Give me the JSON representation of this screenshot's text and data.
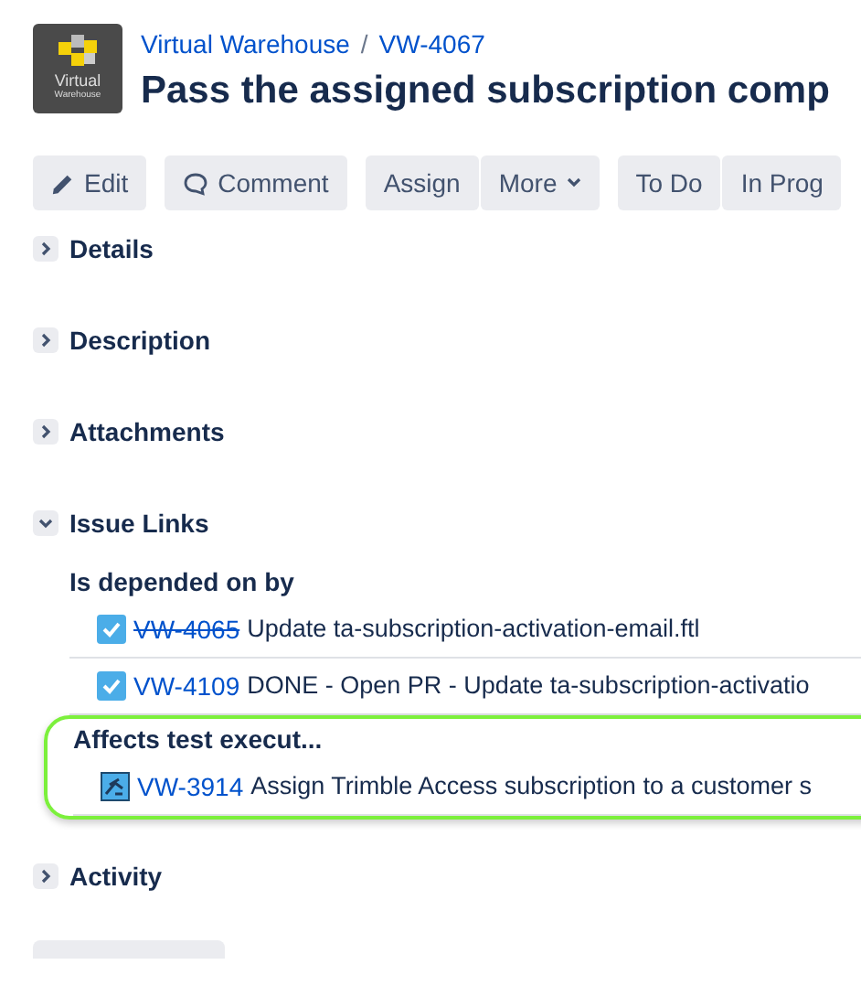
{
  "header": {
    "project_logo_text": "Virtual",
    "project_logo_subtext": "Warehouse",
    "breadcrumbs": [
      "Virtual Warehouse",
      "VW-4067"
    ],
    "breadcrumb_separator": "/",
    "title": "Pass the assigned subscription comp"
  },
  "toolbar": [
    {
      "label": "Edit",
      "kind": "edit"
    },
    {
      "label": "Comment",
      "kind": "comment"
    },
    {
      "label": "Assign",
      "kind": "plain"
    },
    {
      "label": "More",
      "kind": "dropdown"
    },
    {
      "label": "To Do",
      "kind": "plain"
    },
    {
      "label": "In Prog",
      "kind": "plain"
    }
  ],
  "sections": [
    {
      "title": "Details",
      "expanded": false
    },
    {
      "title": "Description",
      "expanded": false
    },
    {
      "title": "Attachments",
      "expanded": false
    },
    {
      "title": "Issue Links",
      "expanded": true,
      "groups": [
        {
          "title": "Is depended on by",
          "highlighted": false,
          "links": [
            {
              "kind": "subtask",
              "key": "VW-4065",
              "resolved": true,
              "summary": "Update ta-subscription-activation-email.ftl"
            },
            {
              "kind": "subtask",
              "key": "VW-4109",
              "resolved": false,
              "summary": "DONE - Open PR - Update ta-subscription-activatio"
            }
          ]
        },
        {
          "title": "Affects test execut...",
          "highlighted": true,
          "links": [
            {
              "kind": "test-execution",
              "key": "VW-3914",
              "resolved": false,
              "summary": "Assign Trimble Access subscription to a customer s"
            }
          ]
        }
      ]
    },
    {
      "title": "Activity",
      "expanded": false
    }
  ]
}
